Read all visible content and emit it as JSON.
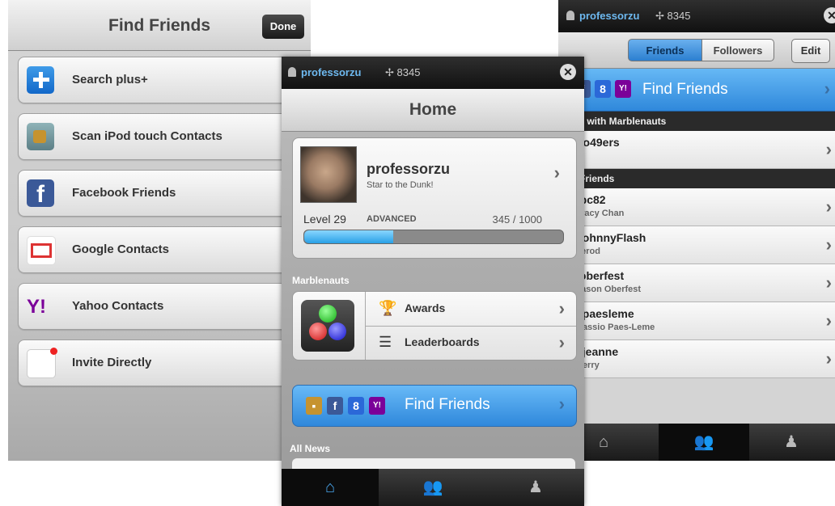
{
  "find_friends": {
    "title": "Find Friends",
    "done_label": "Done",
    "items": [
      {
        "label": "Search plus+",
        "icon": "search-plus-icon"
      },
      {
        "label": "Scan iPod touch Contacts",
        "icon": "contacts-icon"
      },
      {
        "label": "Facebook Friends",
        "icon": "facebook-icon"
      },
      {
        "label": "Google Contacts",
        "icon": "gmail-icon"
      },
      {
        "label": "Yahoo Contacts",
        "icon": "yahoo-icon"
      },
      {
        "label": "Invite Directly",
        "icon": "mail-icon"
      }
    ]
  },
  "home": {
    "top_bar": {
      "username": "professorzu",
      "points": "8345",
      "close_icon": "close-icon"
    },
    "title": "Home",
    "profile": {
      "username": "professorzu",
      "tagline": "Star to the Dunk!",
      "level": "Level 29",
      "rank": "ADVANCED",
      "xp": "345 / 1000",
      "xp_fraction": 0.345
    },
    "game_section": "Marblenauts",
    "game_items": [
      {
        "label": "Awards",
        "icon": "trophy-icon"
      },
      {
        "label": "Leaderboards",
        "icon": "list-icon"
      }
    ],
    "find_friends_label": "Find Friends",
    "news_header": "All News",
    "tabs": [
      "home-icon",
      "friends-icon",
      "profile-icon"
    ]
  },
  "friends": {
    "top_bar": {
      "username": "professorzu",
      "points": "8345"
    },
    "segments": [
      "Friends",
      "Followers"
    ],
    "edit_label": "Edit",
    "find_friends_label": "Find Friends",
    "section1": "ends with Marblenauts",
    "section1_rows": [
      {
        "name": "go49ers",
        "sub": ""
      }
    ],
    "section2": "her Friends",
    "section2_rows": [
      {
        "name": "tpc82",
        "sub": "Tracy Chan"
      },
      {
        "name": "JohnnyFlash",
        "sub": "Jerod"
      },
      {
        "name": "joberfest",
        "sub": "Jason Oberfest"
      },
      {
        "name": "cpaesleme",
        "sub": "Cassio Paes-Leme"
      },
      {
        "name": "kjeanne",
        "sub": "Kerry"
      }
    ]
  },
  "colors": {
    "accent": "#2f88db",
    "link": "#6eb9f0"
  }
}
